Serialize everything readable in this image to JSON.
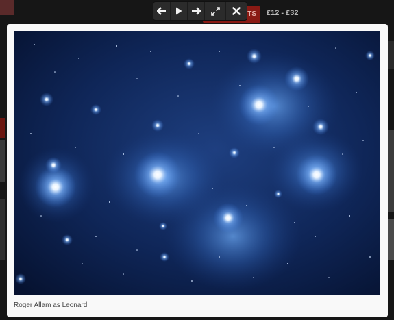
{
  "background": {
    "tickets_button": "ETS",
    "price": "£12 - £32"
  },
  "toolbar": {
    "prev": "arrow-left-icon",
    "play": "play-icon",
    "next": "arrow-right-icon",
    "fullscreen": "expand-icon",
    "close": "close-icon"
  },
  "lightbox": {
    "image_subject": "Star cluster",
    "caption": "Roger Allam as Leonard"
  },
  "colors": {
    "panel": "#f9f9f9",
    "toolbar": "#2b2b2b",
    "ticket_red": "#8a1a14"
  }
}
